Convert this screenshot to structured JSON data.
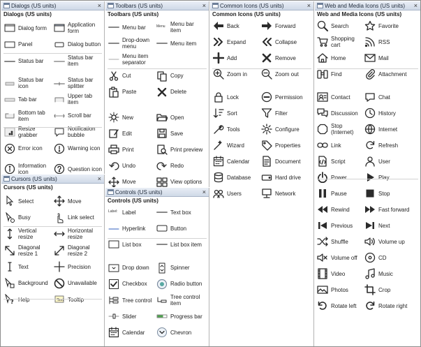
{
  "dialogs": {
    "header": "Dialogs (US units)",
    "title": "Dialogs (US units)",
    "items": [
      {
        "label": "Dialog form",
        "icon": "dialog-form-icon"
      },
      {
        "label": "Application form",
        "icon": "application-form-icon"
      },
      {
        "label": "Panel",
        "icon": "panel-icon"
      },
      {
        "label": "Dialog button",
        "icon": "dialog-button-icon"
      },
      {
        "label": "Status bar",
        "icon": "status-bar-icon"
      },
      {
        "label": "Status bar item",
        "icon": "status-bar-item-icon"
      },
      {
        "label": "Status bar icon",
        "icon": "status-bar-icon-icon"
      },
      {
        "label": "Status bar splitter",
        "icon": "status-bar-splitter-icon"
      },
      {
        "label": "Tab bar",
        "icon": "tab-bar-icon"
      },
      {
        "label": "Upper tab item",
        "icon": "upper-tab-item-icon"
      },
      {
        "label": "Bottom tab item",
        "icon": "bottom-tab-item-icon"
      },
      {
        "label": "Scroll bar",
        "icon": "scroll-bar-icon"
      },
      {
        "label": "Resize grabber",
        "icon": "resize-grabber-icon"
      },
      {
        "label": "Notification bubble",
        "icon": "notification-bubble-icon"
      },
      {
        "label": "Error icon",
        "icon": "error-icon"
      },
      {
        "label": "Warning icon",
        "icon": "warning-icon"
      },
      {
        "label": "Information icon",
        "icon": "information-icon"
      },
      {
        "label": "Question icon",
        "icon": "question-icon"
      }
    ]
  },
  "cursors": {
    "header": "Cursors (US units)",
    "title": "Cursors (US units)",
    "items": [
      {
        "label": "Select",
        "icon": "select-cursor-icon"
      },
      {
        "label": "Move",
        "icon": "move-cursor-icon"
      },
      {
        "label": "Busy",
        "icon": "busy-cursor-icon"
      },
      {
        "label": "Link select",
        "icon": "link-select-cursor-icon"
      },
      {
        "label": "Vertical resize",
        "icon": "vertical-resize-cursor-icon"
      },
      {
        "label": "Horizontal resize",
        "icon": "horizontal-resize-cursor-icon"
      },
      {
        "label": "Diagonal resize 1",
        "icon": "diagonal-resize-1-cursor-icon"
      },
      {
        "label": "Diagonal resize 2",
        "icon": "diagonal-resize-2-cursor-icon"
      },
      {
        "label": "Text",
        "icon": "text-cursor-icon"
      },
      {
        "label": "Precision",
        "icon": "precision-cursor-icon"
      },
      {
        "label": "Background",
        "icon": "background-cursor-icon"
      },
      {
        "label": "Unavailable",
        "icon": "unavailable-cursor-icon"
      },
      {
        "label": "Help",
        "icon": "help-cursor-icon"
      },
      {
        "label": "Tooltip",
        "icon": "tooltip-icon"
      }
    ]
  },
  "toolbars": {
    "header": "Toolbars (US units)",
    "title": "Toolbars (US units)",
    "items": [
      {
        "label": "Menu bar",
        "icon": "menu-bar-icon"
      },
      {
        "label": "Menu bar item",
        "icon": "menu-bar-item-icon",
        "chip": "Menu"
      },
      {
        "label": "Drop-down menu",
        "icon": "drop-down-menu-icon"
      },
      {
        "label": "Menu item",
        "icon": "menu-item-icon"
      },
      {
        "label": "Menu item separator",
        "icon": "menu-item-separator-icon"
      },
      {
        "label": "Cut",
        "icon": "cut-icon"
      },
      {
        "label": "Copy",
        "icon": "copy-icon"
      },
      {
        "label": "Paste",
        "icon": "paste-icon"
      },
      {
        "label": "Delete",
        "icon": "delete-icon"
      },
      {
        "label": "New",
        "icon": "new-icon"
      },
      {
        "label": "Open",
        "icon": "open-icon"
      },
      {
        "label": "Edit",
        "icon": "edit-icon"
      },
      {
        "label": "Save",
        "icon": "save-icon"
      },
      {
        "label": "Print",
        "icon": "print-icon"
      },
      {
        "label": "Print preview",
        "icon": "print-preview-icon"
      },
      {
        "label": "Undo",
        "icon": "undo-icon"
      },
      {
        "label": "Redo",
        "icon": "redo-icon"
      },
      {
        "label": "Move",
        "icon": "move-icon"
      },
      {
        "label": "View options",
        "icon": "view-options-icon"
      }
    ]
  },
  "controls": {
    "header": "Controls (US units)",
    "title": "Controls (US units)",
    "items": [
      {
        "label": "Label",
        "icon": "label-icon",
        "chip": "Label:"
      },
      {
        "label": "Text box",
        "icon": "text-box-icon"
      },
      {
        "label": "Hyperlink",
        "icon": "hyperlink-icon"
      },
      {
        "label": "Button",
        "icon": "button-icon"
      },
      {
        "label": "List box",
        "icon": "list-box-icon"
      },
      {
        "label": "List box item",
        "icon": "list-box-item-icon"
      },
      {
        "label": "Drop down",
        "icon": "drop-down-icon"
      },
      {
        "label": "Spinner",
        "icon": "spinner-icon"
      },
      {
        "label": "Checkbox",
        "icon": "checkbox-icon"
      },
      {
        "label": "Radio button",
        "icon": "radio-button-icon"
      },
      {
        "label": "Tree control",
        "icon": "tree-control-icon"
      },
      {
        "label": "Tree control item",
        "icon": "tree-control-item-icon"
      },
      {
        "label": "Slider",
        "icon": "slider-icon"
      },
      {
        "label": "Progress bar",
        "icon": "progress-bar-icon"
      },
      {
        "label": "Calendar",
        "icon": "calendar-icon"
      },
      {
        "label": "Chevron",
        "icon": "chevron-icon"
      }
    ]
  },
  "common": {
    "header": "Common Icons (US units)",
    "title": "Common Icons (US units)",
    "items": [
      {
        "label": "Back",
        "icon": "back-arrow-icon"
      },
      {
        "label": "Forward",
        "icon": "forward-arrow-icon"
      },
      {
        "label": "Expand",
        "icon": "expand-icon"
      },
      {
        "label": "Collapse",
        "icon": "collapse-icon"
      },
      {
        "label": "Add",
        "icon": "add-icon"
      },
      {
        "label": "Remove",
        "icon": "remove-icon"
      },
      {
        "label": "Zoom in",
        "icon": "zoom-in-icon"
      },
      {
        "label": "Zoom out",
        "icon": "zoom-out-icon"
      },
      {
        "label": "Lock",
        "icon": "lock-icon"
      },
      {
        "label": "Permission",
        "icon": "permission-icon"
      },
      {
        "label": "Sort",
        "icon": "sort-icon"
      },
      {
        "label": "Filter",
        "icon": "filter-icon"
      },
      {
        "label": "Tools",
        "icon": "tools-icon"
      },
      {
        "label": "Configure",
        "icon": "configure-icon"
      },
      {
        "label": "Wizard",
        "icon": "wizard-icon"
      },
      {
        "label": "Properties",
        "icon": "properties-icon"
      },
      {
        "label": "Calendar",
        "icon": "calendar-icon"
      },
      {
        "label": "Document",
        "icon": "document-icon"
      },
      {
        "label": "Database",
        "icon": "database-icon"
      },
      {
        "label": "Hard drive",
        "icon": "hard-drive-icon"
      },
      {
        "label": "Users",
        "icon": "users-icon"
      },
      {
        "label": "Network",
        "icon": "network-icon"
      }
    ]
  },
  "web": {
    "header": "Web and Media Icons (US units)",
    "title": "Web and Media Icons (US units)",
    "items": [
      {
        "label": "Search",
        "icon": "search-icon"
      },
      {
        "label": "Favorite",
        "icon": "favorite-icon"
      },
      {
        "label": "Shopping cart",
        "icon": "shopping-cart-icon"
      },
      {
        "label": "RSS",
        "icon": "rss-icon"
      },
      {
        "label": "Home",
        "icon": "home-icon"
      },
      {
        "label": "Mail",
        "icon": "mail-icon"
      },
      {
        "label": "Find",
        "icon": "find-icon"
      },
      {
        "label": "Attachment",
        "icon": "attachment-icon"
      },
      {
        "label": "Contact",
        "icon": "contact-icon"
      },
      {
        "label": "Chat",
        "icon": "chat-icon"
      },
      {
        "label": "Discussion",
        "icon": "discussion-icon"
      },
      {
        "label": "History",
        "icon": "history-icon"
      },
      {
        "label": "Stop (Internet)",
        "icon": "stop-internet-icon"
      },
      {
        "label": "Internet",
        "icon": "internet-icon"
      },
      {
        "label": "Link",
        "icon": "link-icon"
      },
      {
        "label": "Refresh",
        "icon": "refresh-icon"
      },
      {
        "label": "Script",
        "icon": "script-icon"
      },
      {
        "label": "User",
        "icon": "user-icon"
      },
      {
        "label": "Power",
        "icon": "power-icon"
      },
      {
        "label": "Play",
        "icon": "play-icon"
      },
      {
        "label": "Pause",
        "icon": "pause-icon"
      },
      {
        "label": "Stop",
        "icon": "stop-icon"
      },
      {
        "label": "Rewind",
        "icon": "rewind-icon"
      },
      {
        "label": "Fast forward",
        "icon": "fast-forward-icon"
      },
      {
        "label": "Previous",
        "icon": "previous-icon"
      },
      {
        "label": "Next",
        "icon": "next-icon"
      },
      {
        "label": "Shuffle",
        "icon": "shuffle-icon"
      },
      {
        "label": "Volume up",
        "icon": "volume-up-icon"
      },
      {
        "label": "Volume off",
        "icon": "volume-off-icon"
      },
      {
        "label": "CD",
        "icon": "cd-icon"
      },
      {
        "label": "Video",
        "icon": "video-icon"
      },
      {
        "label": "Music",
        "icon": "music-icon"
      },
      {
        "label": "Photos",
        "icon": "photos-icon"
      },
      {
        "label": "Crop",
        "icon": "crop-icon"
      },
      {
        "label": "Rotate left",
        "icon": "rotate-left-icon"
      },
      {
        "label": "Rotate right",
        "icon": "rotate-right-icon"
      }
    ]
  },
  "close_glyph": "×"
}
